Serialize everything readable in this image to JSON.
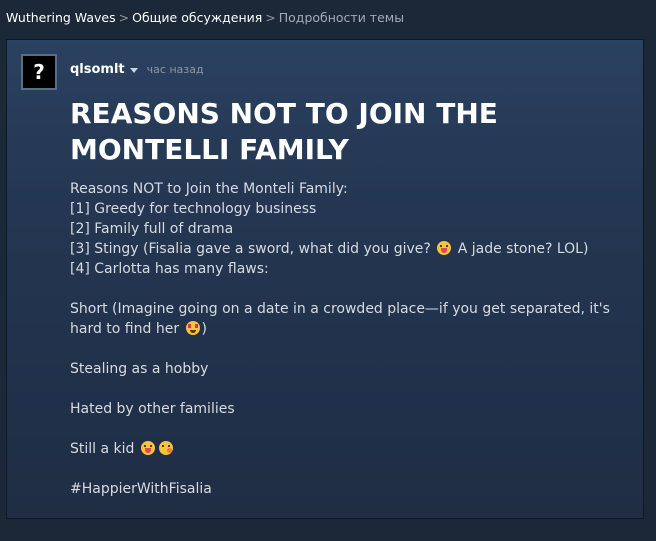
{
  "breadcrumbs": {
    "game": "Wuthering Waves",
    "section": "Общие обсуждения",
    "current": "Подробности темы",
    "separator": ">"
  },
  "post": {
    "avatar_char": "?",
    "author": "qlsomlt",
    "time": "час назад",
    "title": "REASONS NOT TO JOIN THE MONTELLI FAMILY",
    "lines": {
      "l1": "Reasons NOT to Join the Monteli Family:",
      "l2": "[1] Greedy for technology business",
      "l3": "[2] Family full of drama",
      "l4a": "[3] Stingy (Fisalia gave a sword, what did you give?",
      "l4b": "A jade stone? LOL)",
      "l5": "[4] Carlotta has many flaws:",
      "short_a": "Short (Imagine going on a date in a crowded place—if you get separated, it's hard to find her",
      "short_b": ")",
      "stealing": "Stealing as a hobby",
      "hated": "Hated by other families",
      "kid": "Still a kid",
      "hashtag": "#HappierWithFisalia"
    },
    "emojis": [
      "face-with-tongue-emoji",
      "heart-eyes-emoji",
      "face-with-tongue-emoji",
      "winking-tongue-emoji"
    ]
  }
}
